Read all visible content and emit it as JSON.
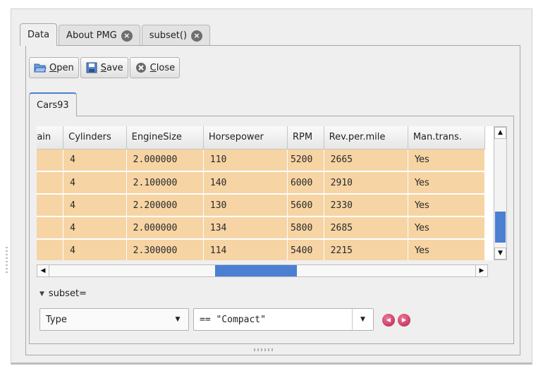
{
  "tabs": [
    {
      "label": "Data"
    },
    {
      "label": "About PMG"
    },
    {
      "label": "subset()"
    }
  ],
  "toolbar": {
    "open_label": "Open",
    "save_label": "Save",
    "close_label": "Close"
  },
  "subtab": {
    "label": "Cars93"
  },
  "table": {
    "columns": [
      "rain",
      "Cylinders",
      "EngineSize",
      "Horsepower",
      "RPM",
      "Rev.per.mile",
      "Man.trans."
    ],
    "rows": [
      [
        "",
        "4",
        "2.000000",
        "110",
        "5200",
        "2665",
        "Yes"
      ],
      [
        "",
        "4",
        "2.100000",
        "140",
        "6000",
        "2910",
        "Yes"
      ],
      [
        "",
        "4",
        "2.200000",
        "130",
        "5600",
        "2330",
        "Yes"
      ],
      [
        "",
        "4",
        "2.000000",
        "134",
        "5800",
        "2685",
        "Yes"
      ],
      [
        "",
        "4",
        "2.300000",
        "114",
        "5400",
        "2215",
        "Yes"
      ]
    ]
  },
  "subset": {
    "expander_label": "subset=",
    "variable_value": "Type",
    "condition_value": "== \"Compact\""
  },
  "icons": {
    "tab_close": "close-circle-icon",
    "open": "folder-open-icon",
    "save": "floppy-disk-icon",
    "close": "close-circle-icon",
    "prev": "previous-icon",
    "next": "next-icon"
  },
  "colors": {
    "selection": "#f6d4a4",
    "accent": "#4a7fd1"
  }
}
